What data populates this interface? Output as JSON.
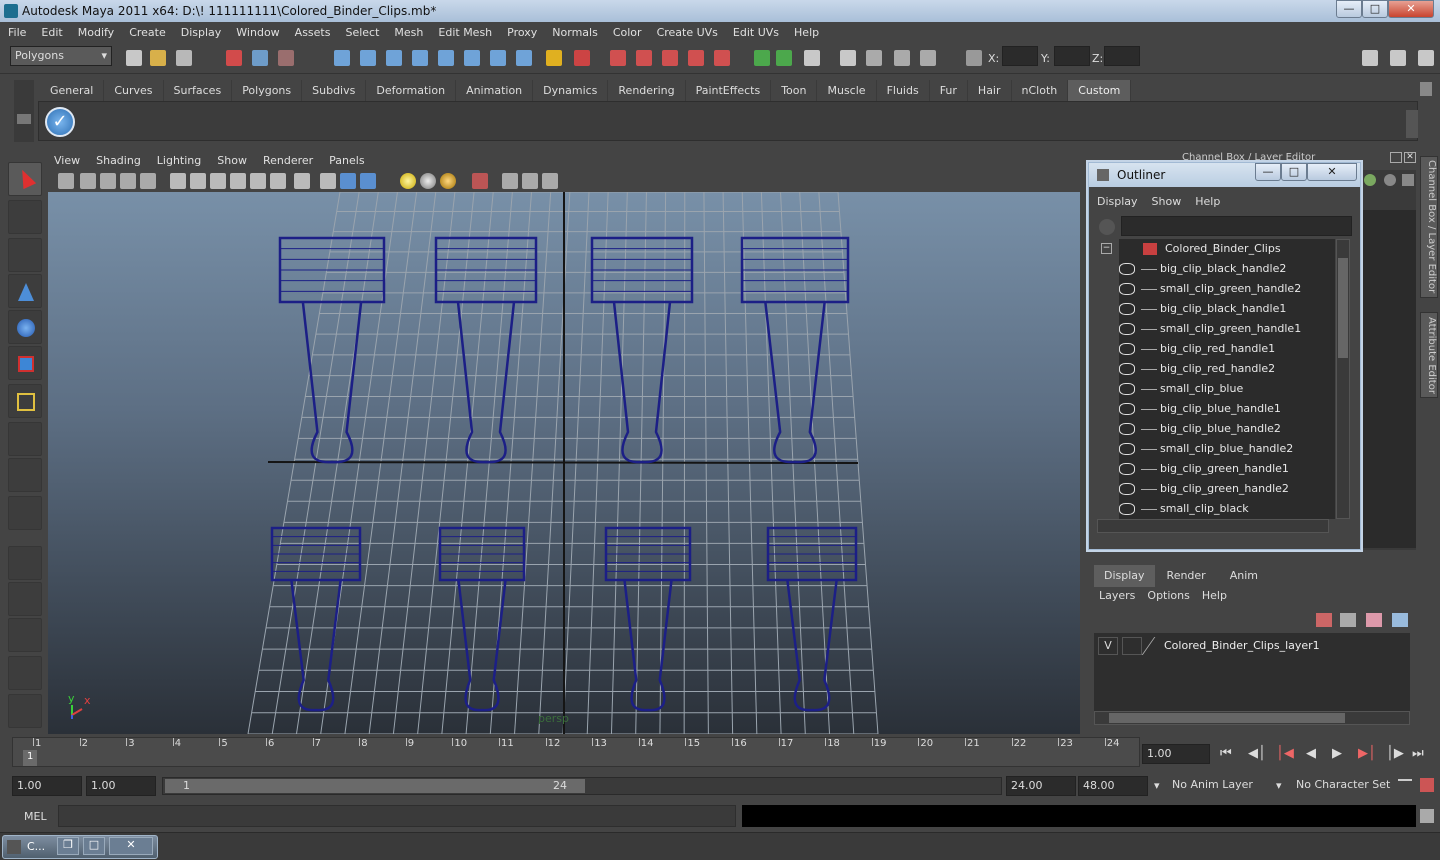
{
  "window": {
    "title": "Autodesk Maya 2011 x64: D:\\! 111111111\\Colored_Binder_Clips.mb*"
  },
  "menubar": [
    "File",
    "Edit",
    "Modify",
    "Create",
    "Display",
    "Window",
    "Assets",
    "Select",
    "Mesh",
    "Edit Mesh",
    "Proxy",
    "Normals",
    "Color",
    "Create UVs",
    "Edit UVs",
    "Help"
  ],
  "status": {
    "mode": "Polygons",
    "x_label": "X:",
    "y_label": "Y:",
    "z_label": "Z:"
  },
  "shelf_tabs": [
    "General",
    "Curves",
    "Surfaces",
    "Polygons",
    "Subdivs",
    "Deformation",
    "Animation",
    "Dynamics",
    "Rendering",
    "PaintEffects",
    "Toon",
    "Muscle",
    "Fluids",
    "Fur",
    "Hair",
    "nCloth",
    "Custom"
  ],
  "viewport": {
    "menu": [
      "View",
      "Shading",
      "Lighting",
      "Show",
      "Renderer",
      "Panels"
    ],
    "camera": "persp",
    "axis_y": "y",
    "axis_x": "x",
    "wire_color": "#1c1f86"
  },
  "panel_header": "Channel Box / Layer Editor",
  "side_tabs": [
    "Channel Box / Layer Editor",
    "Attribute Editor"
  ],
  "outliner": {
    "title": "Outliner",
    "menu": [
      "Display",
      "Show",
      "Help"
    ],
    "root": "Colored_Binder_Clips",
    "items": [
      "big_clip_black_handle2",
      "small_clip_green_handle2",
      "big_clip_black_handle1",
      "small_clip_green_handle1",
      "big_clip_red_handle1",
      "big_clip_red_handle2",
      "small_clip_blue",
      "big_clip_blue_handle1",
      "big_clip_blue_handle2",
      "small_clip_blue_handle2",
      "big_clip_green_handle1",
      "big_clip_green_handle2",
      "small_clip_black"
    ]
  },
  "layer_editor": {
    "tabs": [
      "Display",
      "Render",
      "Anim"
    ],
    "menu": [
      "Layers",
      "Options",
      "Help"
    ],
    "layer_visible": "V",
    "layer_name": "Colored_Binder_Clips_layer1"
  },
  "timeline": {
    "ticks": [
      "1",
      "2",
      "3",
      "4",
      "5",
      "6",
      "7",
      "8",
      "9",
      "10",
      "11",
      "12",
      "13",
      "14",
      "15",
      "16",
      "17",
      "18",
      "19",
      "20",
      "21",
      "22",
      "23",
      "24"
    ],
    "current_frame_marker": "1",
    "current_time": "1.00"
  },
  "range": {
    "start_time": "1.00",
    "start_playback": "1.00",
    "slider_start": "1",
    "slider_end": "24",
    "end_playback": "24.00",
    "end_time": "48.00",
    "anim_layer": "No Anim Layer",
    "char_set": "No Character Set"
  },
  "command_line": {
    "label": "MEL"
  },
  "taskbar": {
    "label": "C..."
  }
}
